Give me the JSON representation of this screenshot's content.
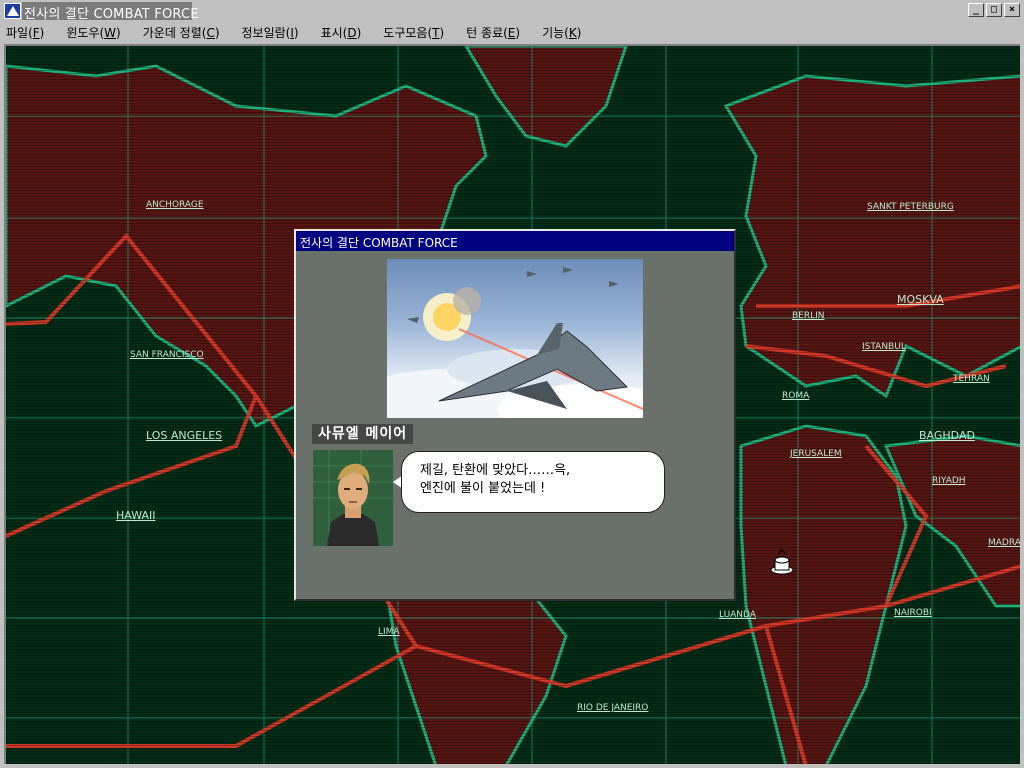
{
  "window": {
    "title": "전사의 결단 COMBAT FORCE",
    "buttons": {
      "minimize": "_",
      "maximize": "□",
      "close": "×"
    }
  },
  "menu": [
    {
      "label": "파일(",
      "key": "F",
      "tail": ")"
    },
    {
      "label": "윈도우(",
      "key": "W",
      "tail": ")"
    },
    {
      "label": "가운데 정렬(",
      "key": "C",
      "tail": ")"
    },
    {
      "label": "정보일람(",
      "key": "I",
      "tail": ")"
    },
    {
      "label": "표시(",
      "key": "D",
      "tail": ")"
    },
    {
      "label": "도구모음(",
      "key": "T",
      "tail": ")"
    },
    {
      "label": "턴 종료(",
      "key": "E",
      "tail": ")"
    },
    {
      "label": "기능(",
      "key": "K",
      "tail": ")"
    }
  ],
  "cities": {
    "anchorage": "ANCHORAGE",
    "san_francisco": "SAN FRANCISCO",
    "los_angeles": "LOS ANGELES",
    "hawaii": "HAWAII",
    "lima": "LIMA",
    "rio": "RIO DE JANEIRO",
    "luanda": "LUANDA",
    "nairobi": "NAIROBI",
    "madras": "MADRA",
    "riyadh": "RIYADH",
    "baghdad": "BAGHDAD",
    "jerusalem": "JERUSALEM",
    "roma": "ROMA",
    "tehran": "TEHRAN",
    "istanbul": "ISTANBUL",
    "berlin": "BERLIN",
    "moskva": "MOSKVA",
    "sankt_peterburg": "SANKT PETERBURG"
  },
  "dialog": {
    "title": "전사의 결단 COMBAT FORCE",
    "speaker": "사뮤엘 메이어",
    "lines": [
      "제길, 탄환에 맞았다……윽,",
      "엔진에 불이 붙었는데 !"
    ]
  },
  "colors": {
    "map_bg": "#042b16",
    "land": "#5a1412",
    "grid": "#1fd0a0",
    "route": "#e03a2a",
    "dialog_title_bar": "#000080",
    "dialog_body": "#6a716b"
  }
}
